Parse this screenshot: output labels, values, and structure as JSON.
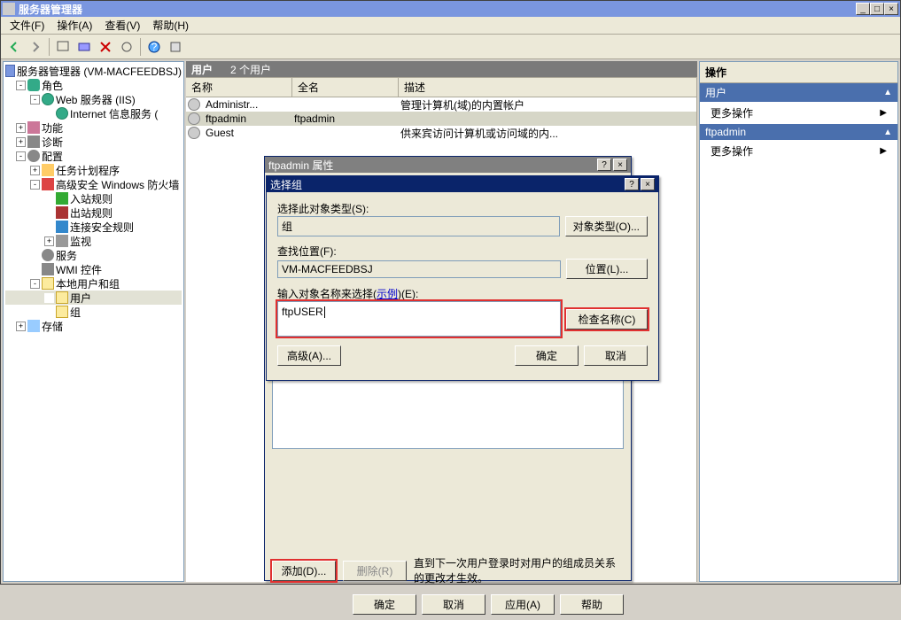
{
  "window": {
    "title": "服务器管理器"
  },
  "menu": {
    "file": "文件(F)",
    "action": "操作(A)",
    "view": "查看(V)",
    "help": "帮助(H)"
  },
  "tree": {
    "root": "服务器管理器 (VM-MACFEEDBSJ)",
    "roles": "角色",
    "webserver": "Web 服务器 (IIS)",
    "iis": "Internet 信息服务 (",
    "features": "功能",
    "diagnostics": "诊断",
    "config": "配置",
    "tasksched": "任务计划程序",
    "firewall": "高级安全 Windows 防火墙",
    "inbound": "入站规则",
    "outbound": "出站规则",
    "connsec": "连接安全规则",
    "monitor": "监视",
    "services": "服务",
    "wmi": "WMI 控件",
    "localusers": "本地用户和组",
    "users": "用户",
    "groups": "组",
    "storage": "存储"
  },
  "center": {
    "title": "用户",
    "count": "2 个用户",
    "cols": {
      "name": "名称",
      "fullname": "全名",
      "desc": "描述"
    },
    "rows": [
      {
        "name": "Administr...",
        "full": "",
        "desc": "管理计算机(域)的内置帐户"
      },
      {
        "name": "ftpadmin",
        "full": "ftpadmin",
        "desc": ""
      },
      {
        "name": "Guest",
        "full": "",
        "desc": "供来宾访问计算机或访问域的内..."
      }
    ]
  },
  "actions": {
    "header": "操作",
    "sec1": "用户",
    "more1": "更多操作",
    "sec2": "ftpadmin",
    "more2": "更多操作"
  },
  "prop": {
    "title": "ftpadmin 属性",
    "add": "添加(D)...",
    "remove": "删除(R)",
    "note": "直到下一次用户登录时对用户的组成员关系的更改才生效。",
    "ok": "确定",
    "cancel": "取消",
    "apply": "应用(A)",
    "help": "帮助"
  },
  "sel": {
    "title": "选择组",
    "objtype_label": "选择此对象类型(S):",
    "objtype_value": "组",
    "objtype_btn": "对象类型(O)...",
    "loc_label": "查找位置(F):",
    "loc_value": "VM-MACFEEDBSJ",
    "loc_btn": "位置(L)...",
    "names_label_a": "输入对象名称来选择(",
    "names_example": "示例",
    "names_label_b": ")(E):",
    "names_value": "ftpUSER",
    "check_btn": "检查名称(C)",
    "advanced": "高级(A)...",
    "ok": "确定",
    "cancel": "取消"
  }
}
